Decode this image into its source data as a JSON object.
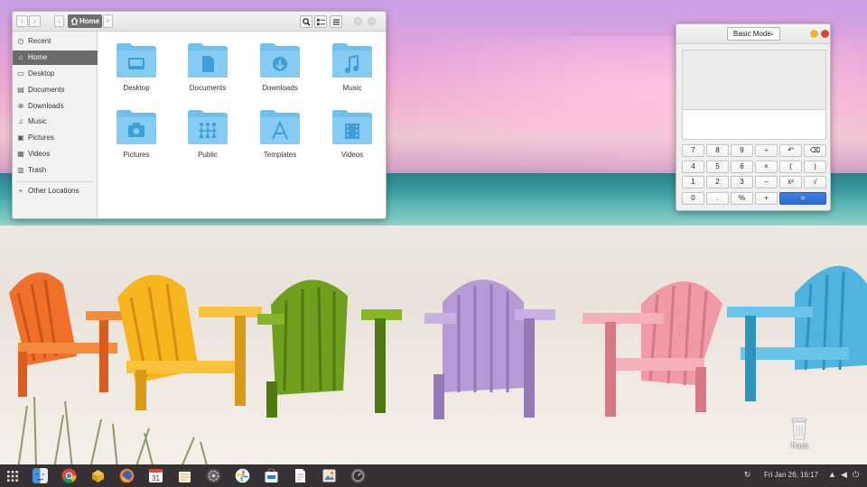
{
  "file_manager": {
    "breadcrumb_home": "Home",
    "sidebar": [
      {
        "label": "Recent",
        "icon": "clock-icon"
      },
      {
        "label": "Home",
        "icon": "home-icon",
        "active": true
      },
      {
        "label": "Desktop",
        "icon": "desktop-icon"
      },
      {
        "label": "Documents",
        "icon": "documents-icon"
      },
      {
        "label": "Downloads",
        "icon": "downloads-icon"
      },
      {
        "label": "Music",
        "icon": "music-icon"
      },
      {
        "label": "Pictures",
        "icon": "pictures-icon"
      },
      {
        "label": "Videos",
        "icon": "videos-icon"
      },
      {
        "label": "Trash",
        "icon": "trash-icon"
      },
      {
        "label": "Other Locations",
        "icon": "plus-icon"
      }
    ],
    "folders": [
      {
        "label": "Desktop",
        "icon": "desktop-folder-icon"
      },
      {
        "label": "Documents",
        "icon": "documents-folder-icon"
      },
      {
        "label": "Downloads",
        "icon": "downloads-folder-icon"
      },
      {
        "label": "Music",
        "icon": "music-folder-icon"
      },
      {
        "label": "Pictures",
        "icon": "pictures-folder-icon"
      },
      {
        "label": "Public",
        "icon": "public-folder-icon"
      },
      {
        "label": "Templates",
        "icon": "templates-folder-icon"
      },
      {
        "label": "Videos",
        "icon": "videos-folder-icon"
      }
    ],
    "folder_color": "#6ec1ee"
  },
  "calculator": {
    "mode_label": "Basic Mode",
    "keys": [
      [
        "7",
        "8",
        "9",
        "÷",
        "↶",
        "⌫"
      ],
      [
        "4",
        "5",
        "6",
        "×",
        "(",
        ")"
      ],
      [
        "1",
        "2",
        "3",
        "−",
        "x²",
        "√"
      ],
      [
        "0",
        ".",
        "%",
        "+",
        "="
      ]
    ],
    "equals_color": "#3377dd"
  },
  "desktop": {
    "trash_label": "Trash"
  },
  "taskbar": {
    "clock": "Fri Jan 26, 16:17",
    "apps": [
      "finder-icon",
      "chrome-icon",
      "package-icon",
      "firefox-icon",
      "calendar-icon",
      "notes-icon",
      "settings-icon",
      "photos-icon",
      "store-icon",
      "text-editor-icon",
      "image-viewer-icon",
      "system-monitor-icon"
    ],
    "calendar_day": "31",
    "tray": [
      "refresh-icon",
      "network-icon",
      "volume-icon",
      "power-icon"
    ]
  }
}
